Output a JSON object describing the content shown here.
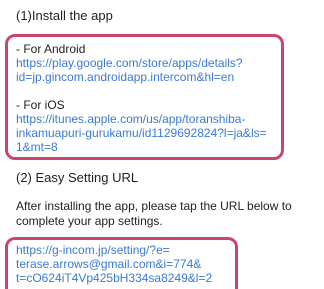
{
  "section1": {
    "heading": "(1)Install the app",
    "android": {
      "label": "- For Android",
      "url_lines": [
        "https://play.google.com/store/apps/details?",
        "id=jp.gincom.androidapp.intercom&hl=en"
      ]
    },
    "ios": {
      "label": "- For iOS",
      "url_lines": [
        "https://itunes.apple.com/us/app/toranshiba-",
        "inkamuapuri-gurukamu/id1129692824?l=ja&ls=",
        "1&mt=8"
      ]
    }
  },
  "section2": {
    "heading": "(2) Easy Setting URL",
    "instructions": [
      "After installing the app, please tap the URL below to",
      "complete your app settings."
    ],
    "url_lines": [
      "https://g-incom.jp/setting/?e=",
      "terase.arrows@gmail.com&i=774&",
      "t=cO624iT4Vp425bH334sa8249&l=2"
    ]
  },
  "colors": {
    "highlight_border": "#c9456e",
    "link": "#3a7ad4",
    "text": "#222222"
  }
}
